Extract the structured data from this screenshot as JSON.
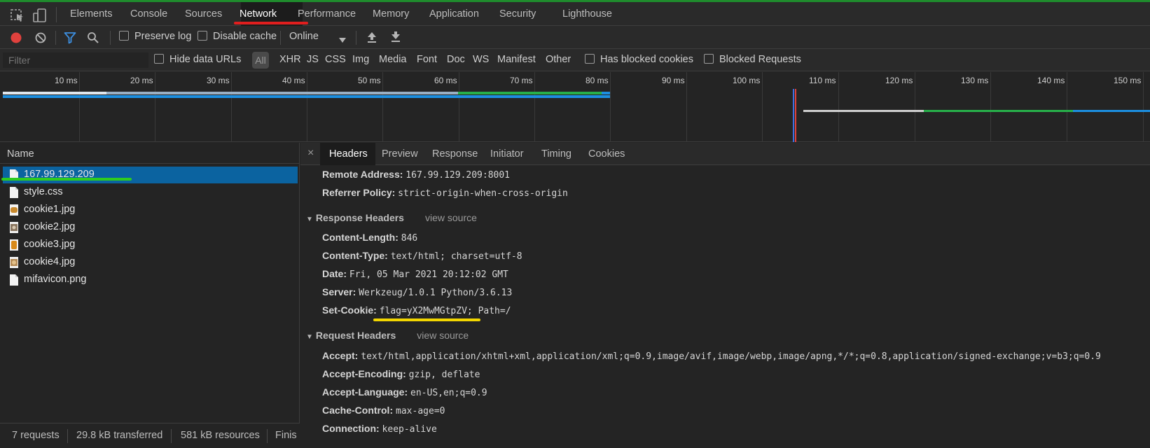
{
  "topbar": {
    "tabs": [
      "Elements",
      "Console",
      "Sources",
      "Network",
      "Performance",
      "Memory",
      "Application",
      "Security",
      "Lighthouse"
    ],
    "active_tab": "Network"
  },
  "toolbar": {
    "preserve_log": "Preserve log",
    "disable_cache": "Disable cache",
    "throttling": "Online"
  },
  "filterbar": {
    "filter_placeholder": "Filter",
    "hide_data_urls": "Hide data URLs",
    "all": "All",
    "types": [
      "XHR",
      "JS",
      "CSS",
      "Img",
      "Media",
      "Font",
      "Doc",
      "WS",
      "Manifest",
      "Other"
    ],
    "has_blocked_cookies": "Has blocked cookies",
    "blocked_requests": "Blocked Requests"
  },
  "overview": {
    "ticks": [
      "10 ms",
      "20 ms",
      "30 ms",
      "40 ms",
      "50 ms",
      "60 ms",
      "70 ms",
      "80 ms",
      "90 ms",
      "100 ms",
      "110 ms",
      "120 ms",
      "130 ms",
      "140 ms",
      "150 ms"
    ]
  },
  "requests": {
    "header": "Name",
    "items": [
      {
        "name": "167.99.129.209",
        "type": "doc",
        "selected": true
      },
      {
        "name": "style.css",
        "type": "doc",
        "selected": false
      },
      {
        "name": "cookie1.jpg",
        "type": "img",
        "selected": false
      },
      {
        "name": "cookie2.jpg",
        "type": "img",
        "selected": false
      },
      {
        "name": "cookie3.jpg",
        "type": "img",
        "selected": false
      },
      {
        "name": "cookie4.jpg",
        "type": "img",
        "selected": false
      },
      {
        "name": "mifavicon.png",
        "type": "doc",
        "selected": false
      }
    ]
  },
  "status": {
    "requests": "7 requests",
    "transferred": "29.8 kB transferred",
    "resources": "581 kB resources",
    "finish": "Finis"
  },
  "details": {
    "close": "×",
    "tabs": [
      "Headers",
      "Preview",
      "Response",
      "Initiator",
      "Timing",
      "Cookies"
    ],
    "active_tab": "Headers",
    "general": [
      {
        "k": "Remote Address:",
        "v": "167.99.129.209:8001"
      },
      {
        "k": "Referrer Policy:",
        "v": "strict-origin-when-cross-origin"
      }
    ],
    "response_title": "Response Headers",
    "view_source": "view source",
    "response": [
      {
        "k": "Content-Length:",
        "v": "846"
      },
      {
        "k": "Content-Type:",
        "v": "text/html; charset=utf-8"
      },
      {
        "k": "Date:",
        "v": "Fri, 05 Mar 2021 20:12:02 GMT"
      },
      {
        "k": "Server:",
        "v": "Werkzeug/1.0.1 Python/3.6.13"
      },
      {
        "k": "Set-Cookie:",
        "v": "flag=yX2MwMGtpZV; Path=/"
      }
    ],
    "request_title": "Request Headers",
    "request": [
      {
        "k": "Accept:",
        "v": "text/html,application/xhtml+xml,application/xml;q=0.9,image/avif,image/webp,image/apng,*/*;q=0.8,application/signed-exchange;v=b3;q=0.9"
      },
      {
        "k": "Accept-Encoding:",
        "v": "gzip, deflate"
      },
      {
        "k": "Accept-Language:",
        "v": "en-US,en;q=0.9"
      },
      {
        "k": "Cache-Control:",
        "v": "max-age=0"
      },
      {
        "k": "Connection:",
        "v": "keep-alive"
      }
    ]
  },
  "colors": {
    "accent_blue": "#3d8fe0",
    "selected_row": "#0b63a0",
    "record_red": "#e0413d",
    "annotation_red": "#e01e1e",
    "annotation_green": "#2ecc1f",
    "annotation_yellow": "#f2d600"
  }
}
